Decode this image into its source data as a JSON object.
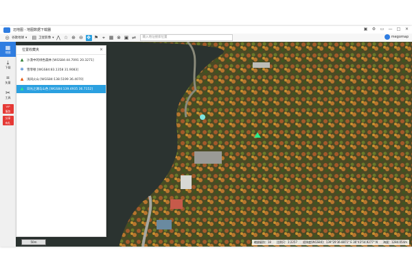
{
  "app": {
    "title": "迈地图 - 地图数据下载器"
  },
  "window_controls": [
    "▣",
    "⚙",
    "▭",
    "—",
    "□",
    "✕"
  ],
  "toolbar": {
    "source": "谷歌地球",
    "view": "卫星影像",
    "search_placeholder": "输入地址搜索位置"
  },
  "brand": {
    "name": "megomap"
  },
  "sidebar": {
    "items": [
      {
        "icon": "map-icon",
        "label": "地图"
      },
      {
        "icon": "download-icon",
        "label": "下载"
      },
      {
        "icon": "vector-icon",
        "label": "矢量"
      },
      {
        "icon": "tools-icon",
        "label": "工具"
      }
    ],
    "promos": [
      "VIP\n服务",
      "分享\n有礼"
    ]
  },
  "panel": {
    "title": "位置收藏夹",
    "items": [
      {
        "label": "沙漠中的绿色森林 [WGS84:44.7091  20.3271]",
        "color": "#2e7d32"
      },
      {
        "label": "雪菲顿 [WGS84:83.1358  31.9083]",
        "color": "#1565c0"
      },
      {
        "label": "浅间火山 [WGS84:138.5199  36.4070]",
        "color": "#e65100"
      },
      {
        "label": "日光之湖与山色 [WGS84:139.4935  36.7152]",
        "color": "#ffffff",
        "selected": true
      }
    ]
  },
  "status": {
    "scale": "50m",
    "level": "缩放级别：18",
    "ratio": "比例尺：1:2257",
    "lng": "经纬度(WGS84)：139°29'36.8871\" E  36°43'54.9277\" N",
    "alt": "海拔：1284.054m"
  }
}
